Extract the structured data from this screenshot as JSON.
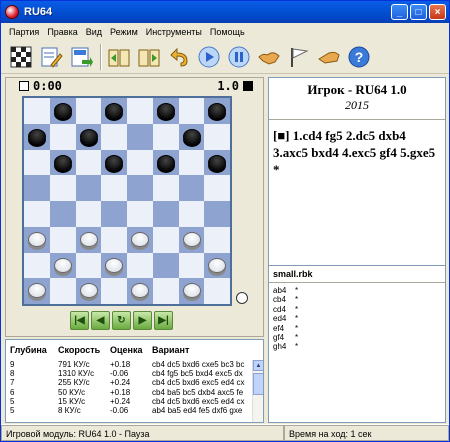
{
  "window": {
    "title": "RU64"
  },
  "menu": [
    "Партия",
    "Правка",
    "Вид",
    "Режим",
    "Инструменты",
    "Помощь"
  ],
  "toolbar": [
    {
      "icon": "board-icon"
    },
    {
      "icon": "edit-icon"
    },
    {
      "icon": "save-icon"
    },
    {
      "icon": "open-book-icon"
    },
    {
      "icon": "book-icon"
    },
    {
      "icon": "undo-icon"
    },
    {
      "icon": "play-icon"
    },
    {
      "icon": "pause-icon"
    },
    {
      "icon": "handshake-icon"
    },
    {
      "icon": "flag-icon"
    },
    {
      "icon": "hand-icon"
    },
    {
      "icon": "help-icon"
    }
  ],
  "clock": {
    "white": "0:00",
    "black": "1.0"
  },
  "board": {
    "rows": [
      [
        "",
        "b",
        "",
        "b",
        "",
        "b",
        "",
        "b"
      ],
      [
        "b",
        "",
        "b",
        "",
        "",
        "",
        "b",
        ""
      ],
      [
        "",
        "b",
        "",
        "b",
        "",
        "b",
        "",
        "b"
      ],
      [
        "",
        "",
        "",
        "",
        "",
        "",
        "",
        ""
      ],
      [
        "",
        "",
        "",
        "",
        "",
        "",
        "",
        ""
      ],
      [
        "w",
        "",
        "w",
        "",
        "w",
        "",
        "w",
        ""
      ],
      [
        "",
        "w",
        "",
        "w",
        "",
        "",
        "",
        "w"
      ],
      [
        "w",
        "",
        "w",
        "",
        "w",
        "",
        "w",
        ""
      ]
    ]
  },
  "info": {
    "title": "Игрок - RU64 1.0",
    "year": "2015",
    "moves": "[■] 1.cd4 fg5 2.dc5 dxb4 3.axc5 bxd4 4.exc5 gf4 5.gxe5 *"
  },
  "book": {
    "title": "small.rbk",
    "entries": [
      {
        "move": "ab4",
        "mark": "*"
      },
      {
        "move": "cb4",
        "mark": "*"
      },
      {
        "move": "cd4",
        "mark": "*"
      },
      {
        "move": "ed4",
        "mark": "*"
      },
      {
        "move": "ef4",
        "mark": "*"
      },
      {
        "move": "gf4",
        "mark": "*"
      },
      {
        "move": "gh4",
        "mark": "*"
      }
    ]
  },
  "analysis": {
    "headers": {
      "depth": "Глубина",
      "speed": "Скорость",
      "score": "Оценка",
      "variant": "Вариант"
    },
    "rows": [
      {
        "depth": "9",
        "speed": "791 КУ/с",
        "score": "+0.18",
        "variant": "cb4 dc5 bxd6 cxe5 bc3 bc"
      },
      {
        "depth": "8",
        "speed": "1310 КУ/с",
        "score": "-0.06",
        "variant": "cb4 fg5 bc5 bxd4 exc5 dx"
      },
      {
        "depth": "7",
        "speed": "255 КУ/с",
        "score": "+0.24",
        "variant": "cb4 dc5 bxd6 exc5 ed4 cx"
      },
      {
        "depth": "6",
        "speed": "50 КУ/с",
        "score": "+0.18",
        "variant": "cb4 ba5 bc5 dxb4 axc5 fe"
      },
      {
        "depth": "5",
        "speed": "15 КУ/с",
        "score": "+0.24",
        "variant": "cb4 dc5 bxd6 exc5 ed4 cx"
      },
      {
        "depth": "5",
        "speed": "8 КУ/с",
        "score": "-0.06",
        "variant": "ab4 ba5 ed4 fe5 dxf6 gxe"
      }
    ]
  },
  "status": {
    "engine": "Игровой модуль: RU64 1.0 - Пауза",
    "time": "Время на ход: 1 сек"
  }
}
